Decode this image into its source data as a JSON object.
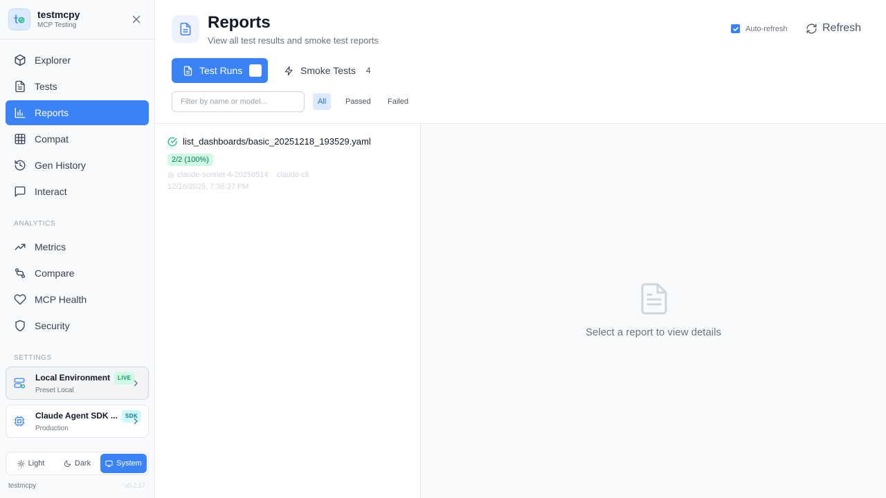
{
  "brand": {
    "name": "testmcpy",
    "subtitle": "MCP Testing"
  },
  "nav": [
    {
      "label": "Explorer",
      "icon": "cube-icon"
    },
    {
      "label": "Tests",
      "icon": "file-text-icon"
    },
    {
      "label": "Reports",
      "icon": "bar-chart-icon",
      "active": true
    },
    {
      "label": "Compat",
      "icon": "grid-icon"
    },
    {
      "label": "Gen History",
      "icon": "history-icon"
    },
    {
      "label": "Interact",
      "icon": "message-square-icon"
    }
  ],
  "sections": {
    "analytics": "ANALYTICS",
    "settings": "SETTINGS"
  },
  "analytics_nav": [
    {
      "label": "Metrics",
      "icon": "trending-up-icon"
    },
    {
      "label": "Compare",
      "icon": "git-compare-icon"
    },
    {
      "label": "MCP Health",
      "icon": "heart-icon"
    },
    {
      "label": "Security",
      "icon": "shield-icon"
    }
  ],
  "environment": {
    "title": "Local Environment",
    "badge": "LIVE",
    "subtitle": "Preset Local"
  },
  "agent": {
    "title": "Claude Agent SDK ...",
    "badge": "SDK",
    "subtitle": "Production"
  },
  "theme": {
    "light": "Light",
    "dark": "Dark",
    "system": "System",
    "selected": "System"
  },
  "footer": {
    "name": "testmcpy",
    "version": "v0.2.17"
  },
  "page": {
    "title": "Reports",
    "subtitle": "View all test results and smoke test reports"
  },
  "auto_refresh": {
    "label": "Auto-refresh",
    "checked": true
  },
  "refresh_label": "Refresh",
  "tabs": {
    "test_runs": {
      "label": "Test Runs"
    },
    "smoke_tests": {
      "label": "Smoke Tests",
      "count": "4"
    }
  },
  "filter": {
    "placeholder": "Filter by name or model...",
    "value": ""
  },
  "status_filters": {
    "all": "All",
    "passed": "Passed",
    "failed": "Failed",
    "selected": "All"
  },
  "reports": [
    {
      "name": "list_dashboards/basic_20251218_193529.yaml",
      "status": "passed",
      "score": "2/2 (100%)",
      "model": "claude-sonnet-4-20250514",
      "provider": "claude-cli",
      "date": "12/18/2025, 7:36:37 PM"
    }
  ],
  "detail": {
    "empty_text": "Select a report to view details"
  },
  "colors": {
    "accent": "#3b82f6",
    "success": "#10b981",
    "success_bg": "#d1fae5"
  }
}
